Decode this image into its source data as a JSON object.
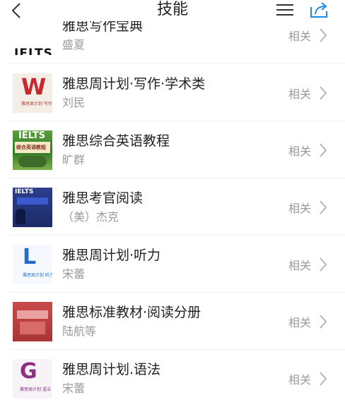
{
  "header": {
    "title": "技能",
    "icons": {
      "back": "chevron-left-icon",
      "menu": "hamburger-menu-icon",
      "share": "share-icon"
    }
  },
  "colors": {
    "accent": "#1e88e5",
    "text_primary": "#222222",
    "text_secondary": "#9a9a9a",
    "divider": "#efefef",
    "chevron": "#b5b5b5"
  },
  "books": [
    {
      "title": "雅思写作宝典",
      "author": "盛夏",
      "related": "相关",
      "cover_text": "IELTS"
    },
    {
      "title": "雅思周计划·写作·学术类",
      "author": "刘民",
      "related": "相关",
      "cover_text": "W",
      "cover_subtext": "雅思周计划 写作"
    },
    {
      "title": "雅思综合英语教程",
      "author": "旷群",
      "related": "相关",
      "cover_text": "IELTS",
      "cover_subtext": "综合英语教程"
    },
    {
      "title": "雅思考官阅读",
      "author": "（美）杰克",
      "related": "相关",
      "cover_text": "IELTS"
    },
    {
      "title": "雅思周计划·听力",
      "author": "宋蕾",
      "related": "相关",
      "cover_text": "L",
      "cover_subtext": "雅思周计划 听力"
    },
    {
      "title": "雅思标准教材·阅读分册",
      "author": "陆航等",
      "related": "相关"
    },
    {
      "title": "雅思周计划.语法",
      "author": "宋蕾",
      "related": "相关",
      "cover_text": "G",
      "cover_subtext": "雅思周计划 语法"
    }
  ]
}
